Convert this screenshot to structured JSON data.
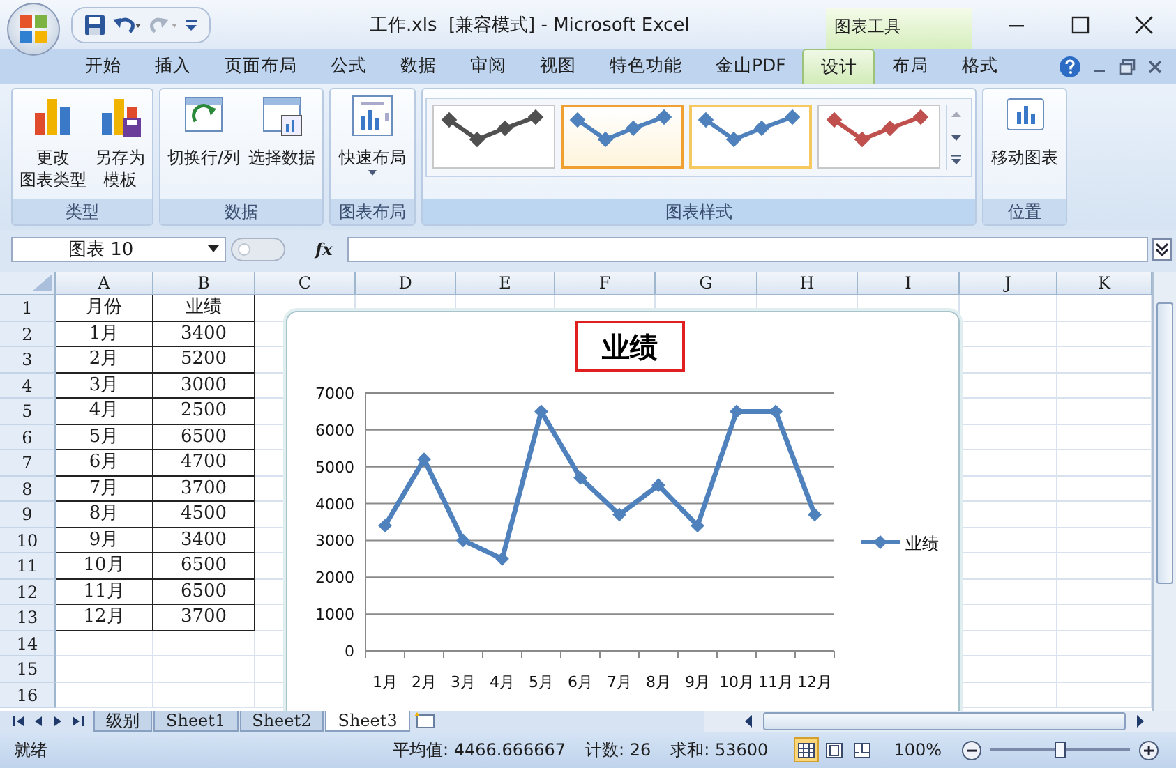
{
  "window": {
    "title": "工作.xls  [兼容模式] - Microsoft Excel",
    "context_tab": "图表工具"
  },
  "ribbon_tabs": [
    {
      "label": "开始",
      "selected": false
    },
    {
      "label": "插入",
      "selected": false
    },
    {
      "label": "页面布局",
      "selected": false
    },
    {
      "label": "公式",
      "selected": false
    },
    {
      "label": "数据",
      "selected": false
    },
    {
      "label": "审阅",
      "selected": false
    },
    {
      "label": "视图",
      "selected": false
    },
    {
      "label": "特色功能",
      "selected": false
    },
    {
      "label": "金山PDF",
      "selected": false
    },
    {
      "label": "设计",
      "selected": true
    },
    {
      "label": "布局",
      "selected": false
    },
    {
      "label": "格式",
      "selected": false
    }
  ],
  "ribbon_groups": [
    {
      "label": "类型",
      "buttons": [
        {
          "lines": [
            "更改",
            "图表类型"
          ]
        },
        {
          "lines": [
            "另存为",
            "模板"
          ]
        }
      ]
    },
    {
      "label": "数据",
      "buttons": [
        {
          "lines": [
            "切换行/列"
          ]
        },
        {
          "lines": [
            "选择数据"
          ]
        }
      ]
    },
    {
      "label": "图表布局",
      "buttons": [
        {
          "lines": [
            "快速布局"
          ]
        }
      ]
    },
    {
      "label": "图表样式",
      "styles": [
        {
          "color": "#505050",
          "selected": false,
          "hovered": false
        },
        {
          "color": "#4f81bd",
          "selected": true,
          "hovered": false
        },
        {
          "color": "#4f81bd",
          "selected": false,
          "hovered": true
        },
        {
          "color": "#c0504d",
          "selected": false,
          "hovered": false
        }
      ]
    },
    {
      "label": "位置",
      "buttons": [
        {
          "lines": [
            "移动图表"
          ]
        }
      ]
    }
  ],
  "formula_bar": {
    "name_box": "图表 10",
    "function_button": "fx"
  },
  "sheet": {
    "columns": [
      "A",
      "B",
      "C",
      "D",
      "E",
      "F",
      "G",
      "H",
      "I",
      "J",
      "K"
    ],
    "rows": [
      {
        "number": "1",
        "cells": [
          "月份",
          "业绩"
        ]
      },
      {
        "number": "2",
        "cells": [
          "1月",
          "3400"
        ]
      },
      {
        "number": "3",
        "cells": [
          "2月",
          "5200"
        ]
      },
      {
        "number": "4",
        "cells": [
          "3月",
          "3000"
        ]
      },
      {
        "number": "5",
        "cells": [
          "4月",
          "2500"
        ]
      },
      {
        "number": "6",
        "cells": [
          "5月",
          "6500"
        ]
      },
      {
        "number": "7",
        "cells": [
          "6月",
          "4700"
        ]
      },
      {
        "number": "8",
        "cells": [
          "7月",
          "3700"
        ]
      },
      {
        "number": "9",
        "cells": [
          "8月",
          "4500"
        ]
      },
      {
        "number": "10",
        "cells": [
          "9月",
          "3400"
        ]
      },
      {
        "number": "11",
        "cells": [
          "10月",
          "6500"
        ]
      },
      {
        "number": "12",
        "cells": [
          "11月",
          "6500"
        ]
      },
      {
        "number": "13",
        "cells": [
          "12月",
          "3700"
        ]
      },
      {
        "number": "14"
      },
      {
        "number": "15"
      },
      {
        "number": "16"
      }
    ]
  },
  "chart": {
    "title": "业绩",
    "chart_data": {
      "type": "line",
      "categories": [
        "1月",
        "2月",
        "3月",
        "4月",
        "5月",
        "6月",
        "7月",
        "8月",
        "9月",
        "10月",
        "11月",
        "12月"
      ],
      "grid": true,
      "series": [
        {
          "name": "业绩",
          "color": "#4f81bd",
          "marker": "diamond",
          "values": [
            3400,
            5200,
            3000,
            2500,
            6500,
            4700,
            3700,
            4500,
            3400,
            6500,
            6500,
            3700
          ]
        }
      ],
      "ylim": [
        0,
        7000
      ],
      "yticks": [
        0,
        1000,
        2000,
        3000,
        4000,
        5000,
        6000,
        7000
      ]
    }
  },
  "sheet_tabs": [
    {
      "label": "级别",
      "selected": false
    },
    {
      "label": "Sheet1",
      "selected": false
    },
    {
      "label": "Sheet2",
      "selected": false
    },
    {
      "label": "Sheet3",
      "selected": true
    }
  ],
  "status_bar": {
    "state": "就绪",
    "average": "平均值: 4466.666667",
    "count": "计数: 26",
    "sum": "求和: 53600",
    "views": [
      {
        "selected": true
      },
      {
        "selected": false
      },
      {
        "selected": false
      }
    ],
    "zoom": "100%",
    "zoom_slider": {
      "level": 0.5
    }
  }
}
